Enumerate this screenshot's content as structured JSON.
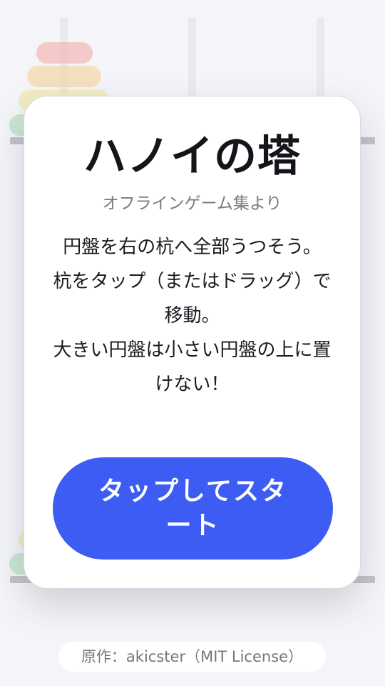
{
  "game": {
    "title": "ハノイの塔",
    "subtitle": "オフラインゲーム集より",
    "rules": [
      "円盤を右の杭へ全部うつそう。",
      "杭をタップ（またはドラッグ）で移動。",
      "大きい円盤は小さい円盤の上に置けない！"
    ],
    "start_label": "タップしてスタート",
    "credit": "原作：akicster（MIT License）"
  },
  "disk_colors": [
    "#f28b82",
    "#f6c26b",
    "#f0dd72",
    "#8fd19e"
  ],
  "background_boards": 2
}
